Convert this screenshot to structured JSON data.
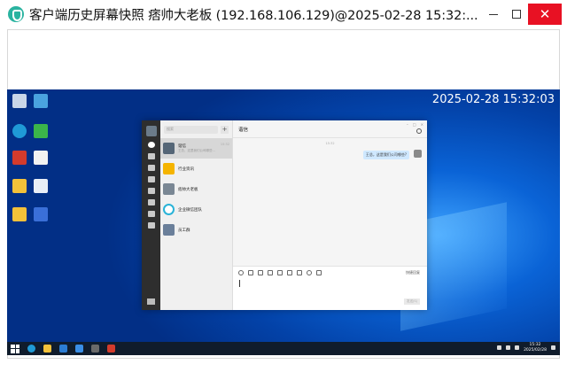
{
  "window": {
    "title": "客户端历史屏幕快照 痞帅大老板 (192.168.106.129)@2025-02-28 15:32:...",
    "minimize_icon": "minimize-icon",
    "maximize_icon": "maximize-icon",
    "close_label": "✕"
  },
  "desktop": {
    "clock": "2025-02-28 15:32:03",
    "icons": [
      "recycle-bin",
      "network",
      "edge",
      "control",
      "app-red",
      "document",
      "folder",
      "document",
      "folder",
      "document"
    ]
  },
  "chat": {
    "search_placeholder": "搜索",
    "plus_label": "+",
    "header_title": "谐信",
    "conversations": [
      {
        "name": "谐信",
        "preview": "王总，这里我们公司哪些...",
        "time": "15:32",
        "avatar_color": "#556677"
      },
      {
        "name": "行业资讯",
        "preview": "",
        "time": "",
        "avatar_color": "#f5b400"
      },
      {
        "name": "痞帅大老板",
        "preview": "",
        "time": "",
        "avatar_color": "#7a8794"
      },
      {
        "name": "企业微信团队",
        "preview": "",
        "time": "",
        "avatar_color": "#2ab3d8"
      },
      {
        "name": "员工群",
        "preview": "",
        "time": "",
        "avatar_color": "#6a7f9a"
      }
    ],
    "message": "王总，这是我们公司哪些?",
    "quick_reply": "快捷回复",
    "send_label": "发送(S)"
  },
  "taskbar": {
    "time": "15:32",
    "date": "2025/02/28"
  }
}
